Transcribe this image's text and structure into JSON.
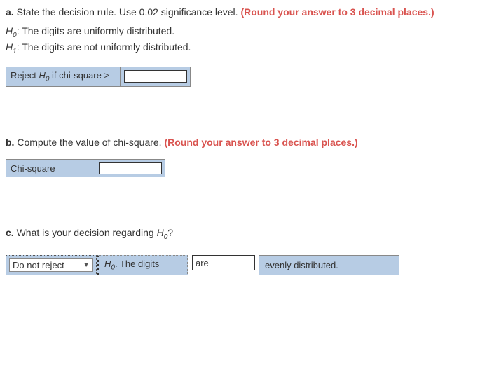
{
  "a": {
    "label": "a.",
    "prompt_main": " State the decision rule. Use 0.02 significance level. ",
    "prompt_red": "(Round your answer to 3 decimal places.)",
    "h0_prefix": "H",
    "h0_sub": "0",
    "h0_text": ": The digits are uniformly distributed.",
    "h1_prefix": "H",
    "h1_sub": "1",
    "h1_text": ": The digits are not uniformly distributed.",
    "cell_label_pre": "Reject ",
    "cell_label_sym": "H",
    "cell_label_sub": "0",
    "cell_label_post": " if chi-square >",
    "value": ""
  },
  "b": {
    "label": "b.",
    "prompt_main": " Compute the value of chi-square. ",
    "prompt_red": "(Round your answer to 3 decimal places.)",
    "cell_label": "Chi-square",
    "value": ""
  },
  "c": {
    "label": "c.",
    "prompt_main_pre": " What is your decision regarding ",
    "prompt_sym": "H",
    "prompt_sub": "0",
    "prompt_q": "?",
    "select_value": "Do not reject",
    "mid_text_pre_sym": "H",
    "mid_text_pre_sub": "0",
    "mid_text_post": ". The digits",
    "box_value": "are",
    "tail_text": "evenly distributed."
  }
}
